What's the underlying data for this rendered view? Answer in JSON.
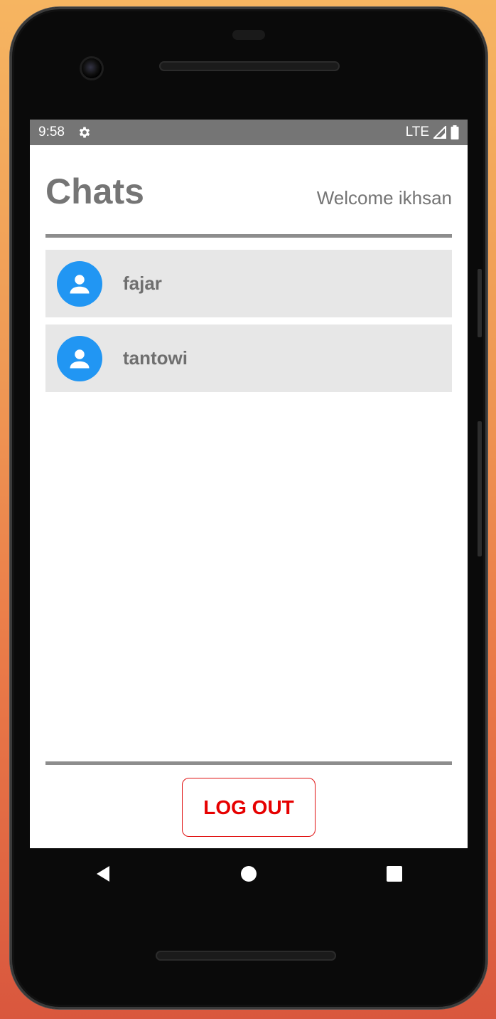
{
  "status_bar": {
    "time": "9:58",
    "network": "LTE",
    "settings_icon": "gear-icon",
    "signal_icon": "signal-icon",
    "battery_icon": "battery-icon",
    "background_color": "#757575"
  },
  "header": {
    "title": "Chats",
    "welcome_text": "Welcome ikhsan"
  },
  "chats": [
    {
      "name": "fajar",
      "avatar_icon": "person-icon"
    },
    {
      "name": "tantowi",
      "avatar_icon": "person-icon"
    }
  ],
  "footer": {
    "logout_label": "LOG OUT"
  },
  "nav_bar": {
    "back_icon": "back-triangle-icon",
    "home_icon": "home-circle-icon",
    "recents_icon": "recents-square-icon"
  },
  "colors": {
    "accent_blue": "#2196f3",
    "logout_red": "#e60000",
    "text_gray": "#757575",
    "item_background": "#e7e7e7"
  }
}
